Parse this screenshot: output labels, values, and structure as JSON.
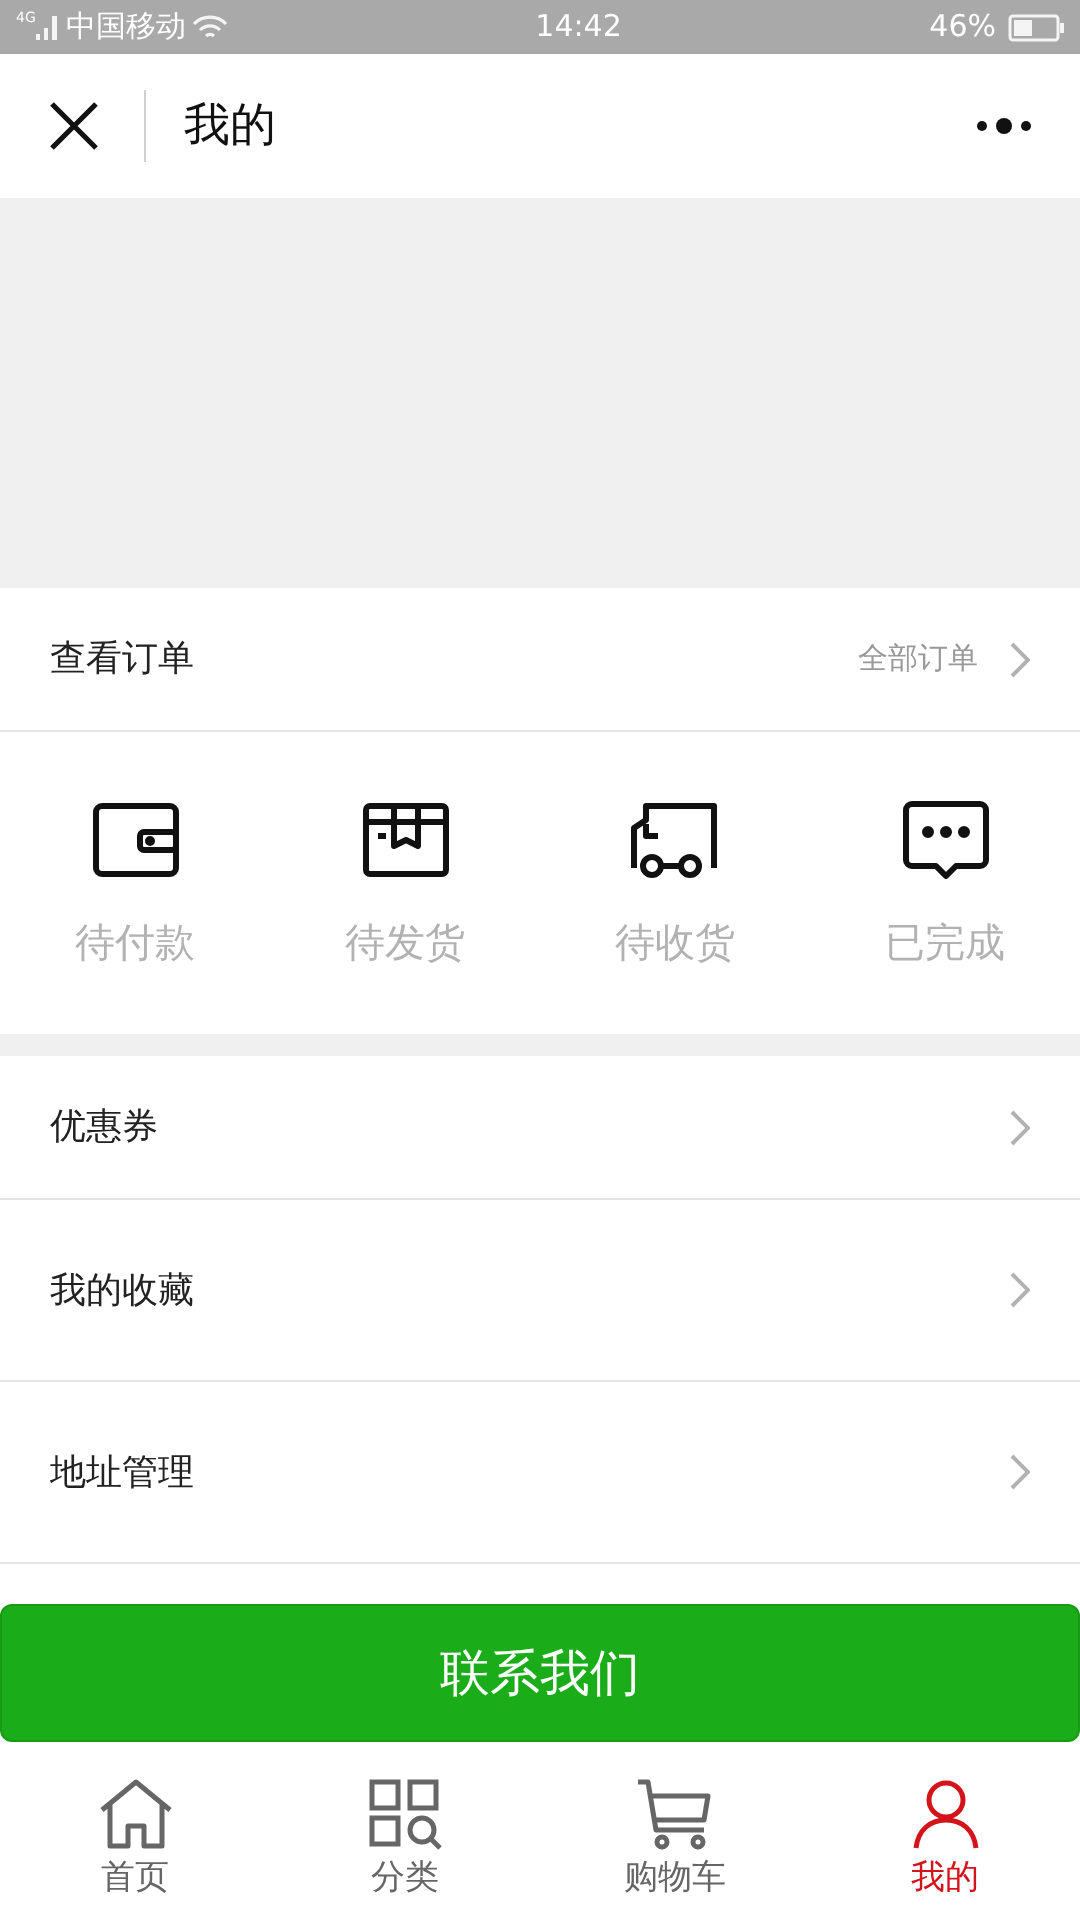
{
  "status_bar": {
    "carrier": "中国移动",
    "network": "4G",
    "time": "14:42",
    "battery": "46%"
  },
  "header": {
    "title": "我的"
  },
  "orders": {
    "title": "查看订单",
    "link": "全部订单",
    "items": [
      {
        "label": "待付款",
        "kind": "wallet"
      },
      {
        "label": "待发货",
        "kind": "box"
      },
      {
        "label": "待收货",
        "kind": "truck"
      },
      {
        "label": "已完成",
        "kind": "chat"
      }
    ]
  },
  "menu": [
    "优惠券",
    "我的收藏",
    "地址管理"
  ],
  "contact_button": "联系我们",
  "tab_bar": [
    {
      "label": "首页",
      "kind": "home",
      "selected": false
    },
    {
      "label": "分类",
      "kind": "category",
      "selected": false
    },
    {
      "label": "购物车",
      "kind": "cart",
      "selected": false
    },
    {
      "label": "我的",
      "kind": "user",
      "selected": true
    }
  ]
}
